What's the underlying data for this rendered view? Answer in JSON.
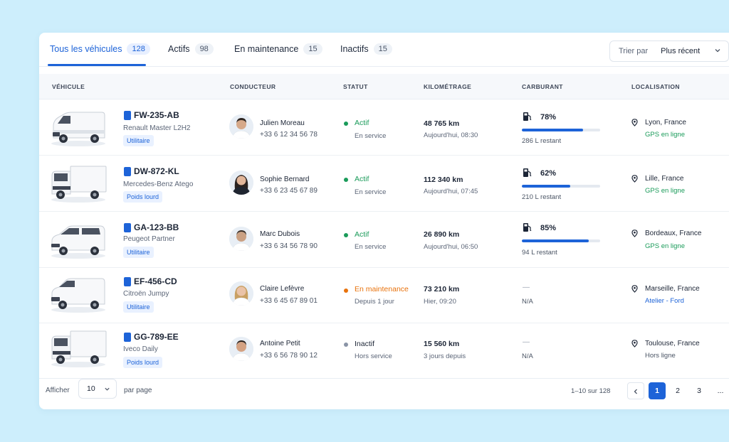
{
  "tabs": [
    {
      "label": "Tous les véhicules",
      "count": "128"
    },
    {
      "label": "Actifs",
      "count": "98"
    },
    {
      "label": "En maintenance",
      "count": "15"
    },
    {
      "label": "Inactifs",
      "count": "15"
    }
  ],
  "sort": {
    "label": "Trier par",
    "value": "Plus récent"
  },
  "columns": [
    "VÉHICULE",
    "CONDUCTEUR",
    "STATUT",
    "KILOMÉTRAGE",
    "CARBURANT",
    "LOCALISATION"
  ],
  "colors": {
    "accent": "#1d63d8",
    "active": "#1a9b5a",
    "maintenance": "#e8720c",
    "inactive": "#8a94a6"
  },
  "rows": [
    {
      "plate": "FW-235-AB",
      "model": "Renault Master L2H2",
      "type": "Utilitaire",
      "driver": "Julien Moreau",
      "phone": "+33 6 12 34 56 78",
      "status": "Actif",
      "status_sub": "En service",
      "km": "48 765 km",
      "km_sub": "Aujourd'hui, 08:30",
      "fuel_pct": "78%",
      "fuel_level": 0.78,
      "fuel_rest": "286 L restant",
      "city": "Lyon, France",
      "loc_sub": "GPS en ligne"
    },
    {
      "plate": "DW-872-KL",
      "model": "Mercedes-Benz Atego",
      "type": "Poids lourd",
      "driver": "Sophie Bernard",
      "phone": "+33 6 23 45 67 89",
      "status": "Actif",
      "status_sub": "En service",
      "km": "112 340 km",
      "km_sub": "Aujourd'hui, 07:45",
      "fuel_pct": "62%",
      "fuel_level": 0.62,
      "fuel_rest": "210 L restant",
      "city": "Lille, France",
      "loc_sub": "GPS en ligne"
    },
    {
      "plate": "GA-123-BB",
      "model": "Peugeot Partner",
      "type": "Utilitaire",
      "driver": "Marc Dubois",
      "phone": "+33 6 34 56 78 90",
      "status": "Actif",
      "status_sub": "En service",
      "km": "26 890 km",
      "km_sub": "Aujourd'hui, 06:50",
      "fuel_pct": "85%",
      "fuel_level": 0.85,
      "fuel_rest": "94 L restant",
      "city": "Bordeaux, France",
      "loc_sub": "GPS en ligne"
    },
    {
      "plate": "EF-456-CD",
      "model": "Citroën Jumpy",
      "type": "Utilitaire",
      "driver": "Claire Lefèvre",
      "phone": "+33 6 45 67 89 01",
      "status": "En maintenance",
      "status_sub": "Depuis 1 jour",
      "km": "73 210 km",
      "km_sub": "Hier, 09:20",
      "fuel_dash": "—",
      "fuel_na": "N/A",
      "city": "Marseille, France",
      "loc_sub": "Atelier - Ford"
    },
    {
      "plate": "GG-789-EE",
      "model": "Iveco Daily",
      "type": "Poids lourd",
      "driver": "Antoine Petit",
      "phone": "+33 6 56 78 90 12",
      "status": "Inactif",
      "status_sub": "Hors service",
      "km": "15 560 km",
      "km_sub": "3 jours depuis",
      "fuel_dash": "—",
      "fuel_na": "N/A",
      "city": "Toulouse, France",
      "loc_sub": "Hors ligne"
    }
  ],
  "footer": {
    "show_label": "Afficher",
    "per_page": "10",
    "per_page_label": "par page",
    "range": "1–10 sur 128",
    "pages": [
      "1",
      "2",
      "3",
      "..."
    ]
  }
}
